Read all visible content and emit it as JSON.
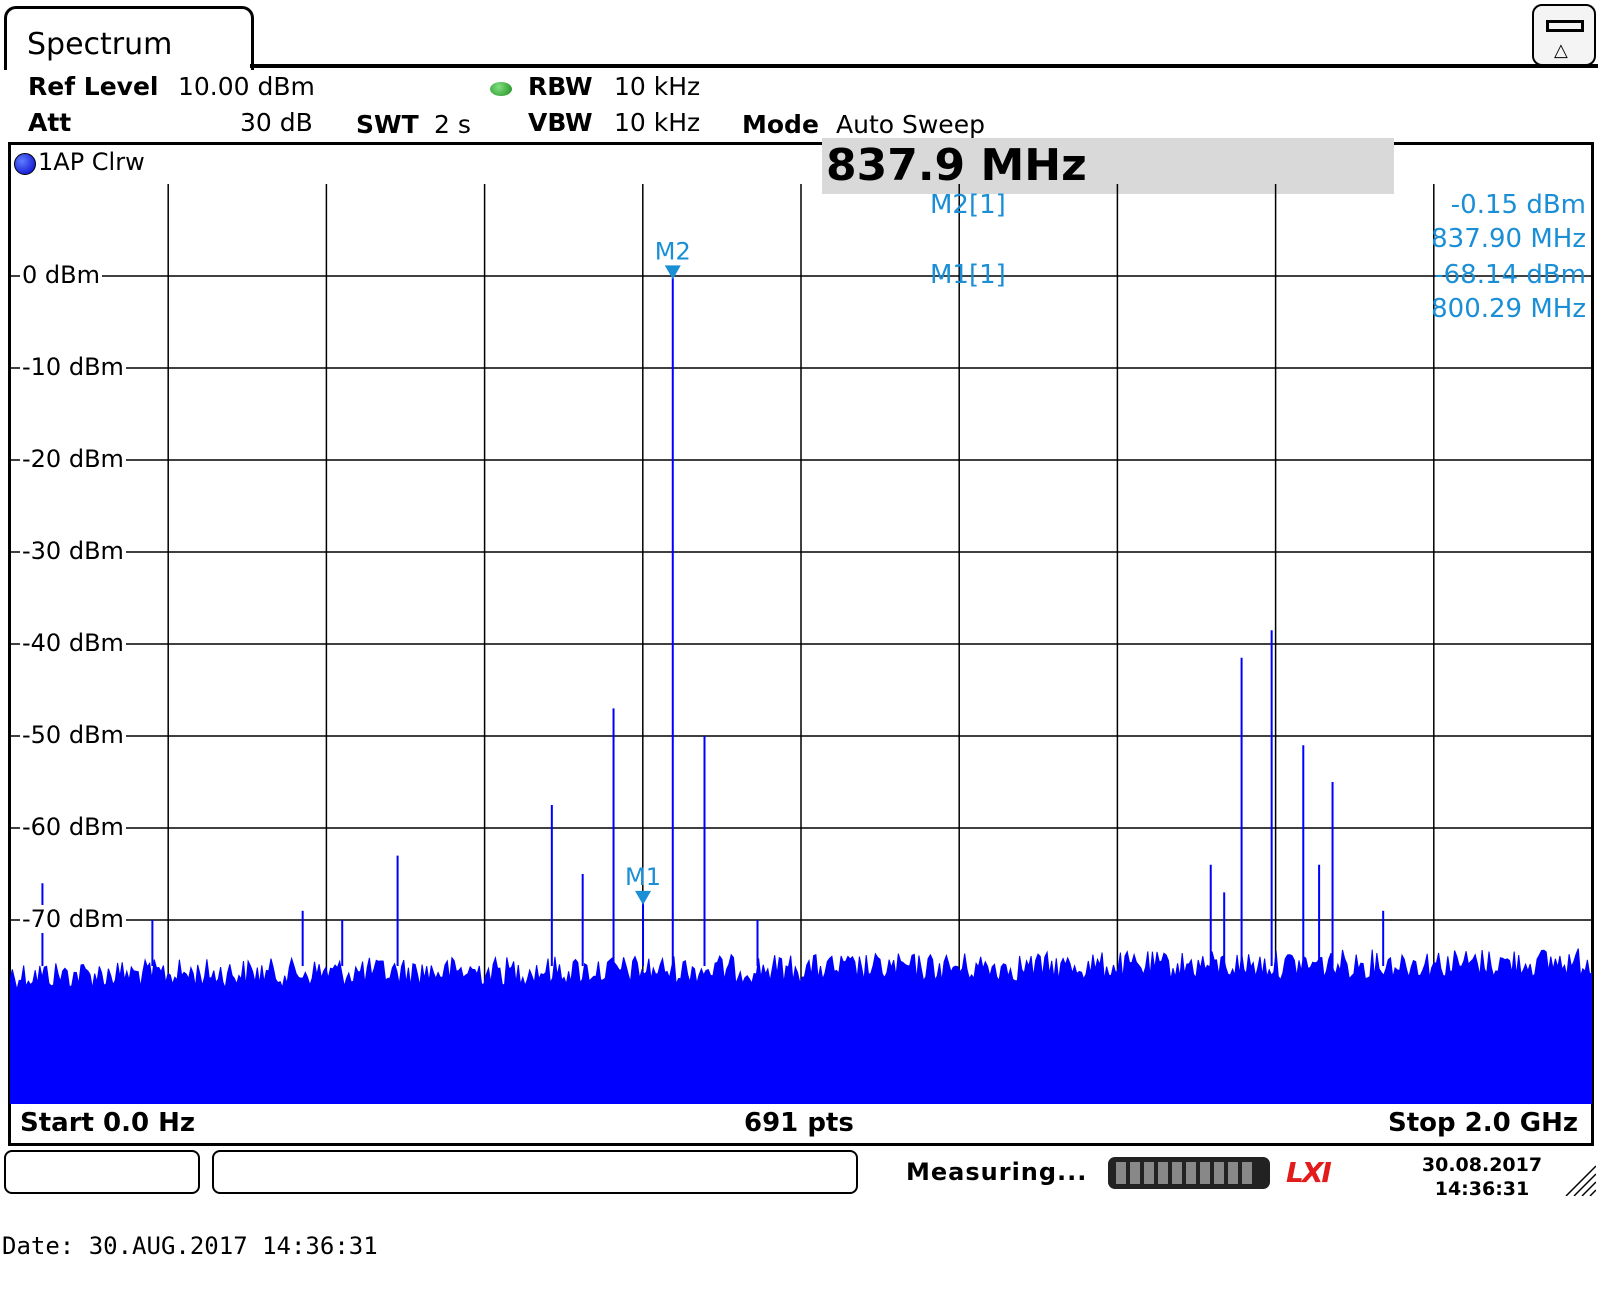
{
  "header": {
    "tab_title": "Spectrum",
    "ref_level_label": "Ref Level",
    "ref_level_value": "10.00 dBm",
    "att_label": "Att",
    "att_value": "30 dB",
    "swt_label": "SWT",
    "swt_value": "2 s",
    "rbw_label": "RBW",
    "rbw_value": "10 kHz",
    "vbw_label": "VBW",
    "vbw_value": "10 kHz",
    "mode_label": "Mode",
    "mode_value": "Auto Sweep",
    "trace_label": "1AP Clrw",
    "center_value": "837.9 MHz",
    "led_color": "#2ea82e"
  },
  "markers": {
    "m2_label": "M2[1]",
    "m2_level": "-0.15 dBm",
    "m2_freq": "837.90 MHz",
    "m1_label": "M1[1]",
    "m1_level": "-68.14 dBm",
    "m1_freq": "800.29 MHz",
    "m2_tag": "M2",
    "m1_tag": "M1",
    "marker_color": "#1b8fd6"
  },
  "footer": {
    "start": "Start 0.0 Hz",
    "points": "691 pts",
    "stop": "Stop 2.0 GHz"
  },
  "status": {
    "text": "Measuring...",
    "logo": "LXI",
    "date": "30.08.2017",
    "time": "14:36:31"
  },
  "date_line": "Date: 30.AUG.2017  14:36:31",
  "chart_data": {
    "type": "line",
    "trace_color": "#0000ff",
    "xlim": [
      0,
      2000
    ],
    "ylim": [
      -90,
      10
    ],
    "y_ticks": [
      0,
      -10,
      -20,
      -30,
      -40,
      -50,
      -60,
      -70
    ],
    "y_tick_labels": [
      "0 dBm",
      "-10 dBm",
      "-20 dBm",
      "-30 dBm",
      "-40 dBm",
      "-50 dBm",
      "-60 dBm",
      "-70 dBm"
    ],
    "grid": true,
    "noise_floor": -74,
    "peaks": [
      {
        "x": 41,
        "y": -66
      },
      {
        "x": 180,
        "y": -70
      },
      {
        "x": 370,
        "y": -69
      },
      {
        "x": 420,
        "y": -70
      },
      {
        "x": 490,
        "y": -63
      },
      {
        "x": 685,
        "y": -57.5
      },
      {
        "x": 724,
        "y": -65
      },
      {
        "x": 763,
        "y": -47
      },
      {
        "x": 800.29,
        "y": -68.14
      },
      {
        "x": 837.9,
        "y": -0.15
      },
      {
        "x": 878,
        "y": -50
      },
      {
        "x": 945,
        "y": -70
      },
      {
        "x": 1518,
        "y": -64
      },
      {
        "x": 1535,
        "y": -67
      },
      {
        "x": 1557,
        "y": -41.5
      },
      {
        "x": 1595,
        "y": -38.5
      },
      {
        "x": 1635,
        "y": -51
      },
      {
        "x": 1655,
        "y": -64
      },
      {
        "x": 1672,
        "y": -55
      },
      {
        "x": 1736,
        "y": -69
      }
    ],
    "markers": [
      {
        "name": "M2",
        "x": 837.9,
        "y": -0.15
      },
      {
        "name": "M1",
        "x": 800.29,
        "y": -68.14
      }
    ]
  }
}
